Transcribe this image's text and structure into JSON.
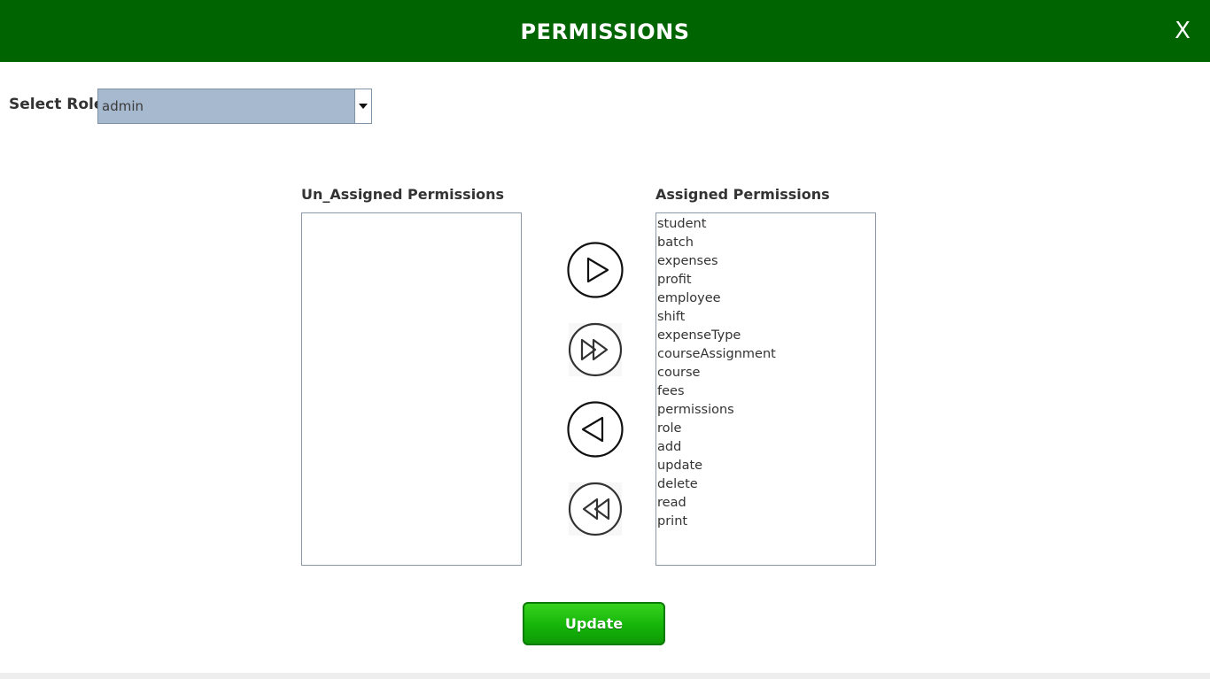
{
  "header": {
    "title": "PERMISSIONS",
    "close_label": "X",
    "background_color": "#006400"
  },
  "role": {
    "label": "Select Role",
    "selected": "admin"
  },
  "unassigned": {
    "title": "Un_Assigned Permissions",
    "items": []
  },
  "assigned": {
    "title": "Assigned Permissions",
    "items": [
      "student",
      "batch",
      "expenses",
      "profit",
      "employee",
      "shift",
      "expenseType",
      "courseAssignment",
      "course",
      "fees",
      "permissions",
      "role",
      "add",
      "update",
      "delete",
      "read",
      "print"
    ]
  },
  "controls": {
    "move_right_icon": "play-right-icon",
    "move_all_right_icon": "fast-forward-icon",
    "move_left_icon": "play-left-icon",
    "move_all_left_icon": "rewind-icon"
  },
  "update_button": {
    "label": "Update",
    "color": "#1fc10e"
  }
}
